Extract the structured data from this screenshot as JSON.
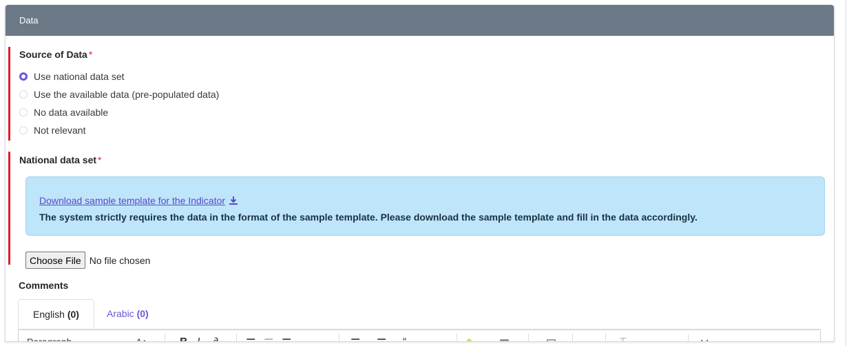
{
  "panel": {
    "title": "Data"
  },
  "source": {
    "label": "Source of Data",
    "required_mark": "*",
    "options": [
      {
        "label": "Use national data set",
        "checked": true
      },
      {
        "label": "Use the available data (pre-populated data)",
        "checked": false
      },
      {
        "label": "No data available",
        "checked": false
      },
      {
        "label": "Not relevant",
        "checked": false
      }
    ]
  },
  "national": {
    "label": "National data set",
    "required_mark": "*",
    "download_link": "Download sample template for the Indicator",
    "info_text": "The system strictly requires the data in the format of the sample template. Please download the sample template and fill in the data accordingly.",
    "choose_file": "Choose File",
    "no_file": "No file chosen"
  },
  "comments": {
    "label": "Comments",
    "tabs": [
      {
        "name": "English",
        "count": "(0)"
      },
      {
        "name": "Arabic",
        "count": "(0)"
      }
    ],
    "toolbar_first": "Paragraph"
  },
  "colors": {
    "header": "#6c7a87",
    "accent": "#6c55d6",
    "required": "#e11b2a",
    "info_bg": "#bfe5fb"
  }
}
